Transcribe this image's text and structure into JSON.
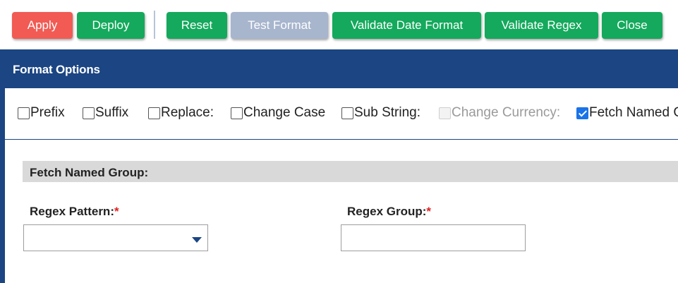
{
  "toolbar": {
    "buttons": [
      {
        "label": "Apply",
        "color": "#f15b54"
      },
      {
        "label": "Deploy",
        "color": "#14a95c"
      },
      {
        "label": "Reset",
        "color": "#14a95c"
      },
      {
        "label": "Test Format",
        "color": "#a7b5cd",
        "disabled": true
      },
      {
        "label": "Validate Date Format",
        "color": "#14a95c"
      },
      {
        "label": "Validate Regex",
        "color": "#14a95c"
      },
      {
        "label": "Close",
        "color": "#14a95c"
      }
    ]
  },
  "panel": {
    "title": "Format Options",
    "options": [
      {
        "label": "Prefix",
        "checked": false,
        "disabled": false
      },
      {
        "label": "Suffix",
        "checked": false,
        "disabled": false
      },
      {
        "label": "Replace:",
        "checked": false,
        "disabled": false
      },
      {
        "label": "Change Case",
        "checked": false,
        "disabled": false
      },
      {
        "label": "Sub String:",
        "checked": false,
        "disabled": false
      },
      {
        "label": "Change Currency:",
        "checked": false,
        "disabled": true
      },
      {
        "label": "Fetch Named Group",
        "checked": true,
        "disabled": false
      }
    ],
    "group": {
      "title": "Fetch Named Group:",
      "regex_pattern_label": "Regex Pattern:",
      "regex_group_label": "Regex Group:",
      "required_mark": "*",
      "regex_pattern_value": "",
      "regex_group_value": ""
    }
  },
  "colors": {
    "header": "#1b4583",
    "green": "#14a95c",
    "red": "#f15b54",
    "disabled": "#a7b5cd",
    "required": "#e02020"
  }
}
